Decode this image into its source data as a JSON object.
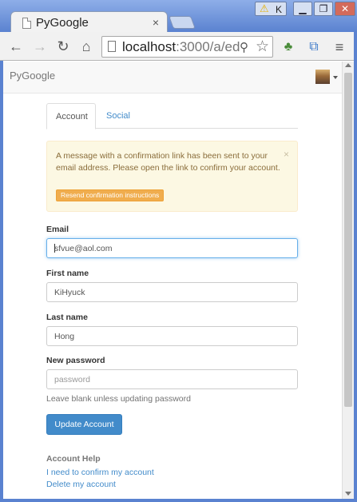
{
  "browser": {
    "tab_title": "PyGoogle",
    "tab_close": "×",
    "warning_icon": "warning-triangle-icon",
    "warning_letter": "K",
    "window_buttons": {
      "minimize": "▁",
      "maximize": "❐",
      "close": "✕"
    },
    "address": {
      "host": "localhost",
      "rest": ":3000/a/ed"
    }
  },
  "page": {
    "brand": "PyGoogle",
    "tabs": {
      "account": "Account",
      "social": "Social"
    },
    "alert": {
      "message": "A message with a confirmation link has been sent to your email address. Please open the link to confirm your account.",
      "close": "×",
      "resend_label": "Resend confirmation instructions"
    },
    "form": {
      "email_label": "Email",
      "email_value": "sfvue@aol.com",
      "first_name_label": "First name",
      "first_name_value": "KiHyuck",
      "last_name_label": "Last name",
      "last_name_value": "Hong",
      "password_label": "New password",
      "password_placeholder": "password",
      "password_help": "Leave blank unless updating password",
      "submit_label": "Update Account"
    },
    "account_help": {
      "heading": "Account Help",
      "links": [
        "I need to confirm my account",
        "Delete my account"
      ]
    }
  },
  "colors": {
    "primary": "#428bca",
    "warning_bg": "#fcf8e3",
    "warning_text": "#8a6d3b",
    "warning_button": "#f0ad4e"
  }
}
